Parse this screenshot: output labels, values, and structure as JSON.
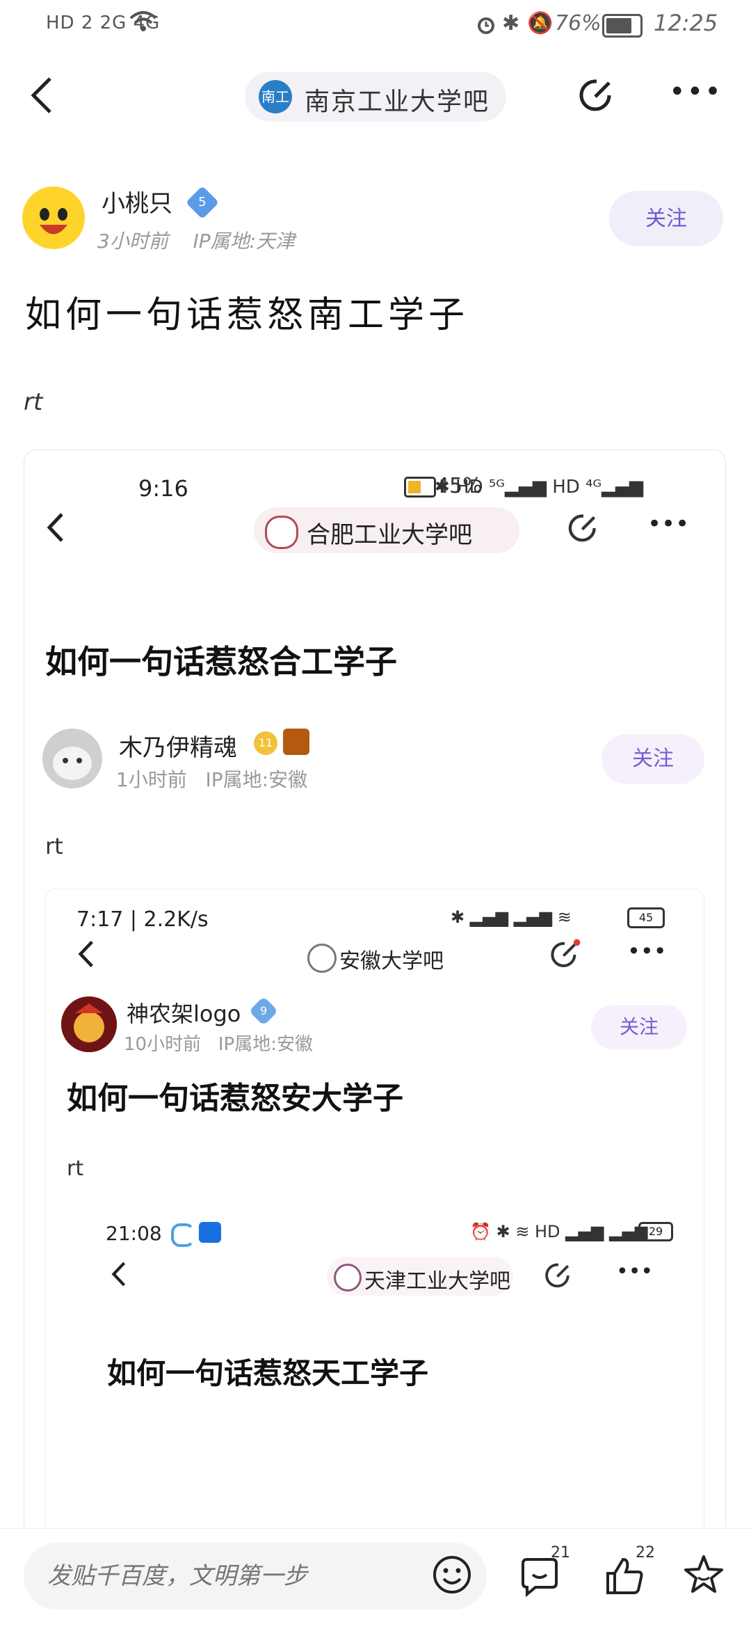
{
  "status_bar": {
    "left": "HD 2  2G  4G",
    "battery": "76%",
    "time": "12:25"
  },
  "nav": {
    "forum_logo_text": "南工",
    "forum_name": "南京工业大学吧"
  },
  "post": {
    "author": "小桃只",
    "level": "5",
    "time": "3小时前",
    "ip": "IP属地:天津",
    "follow": "关注",
    "title": "如何一句话惹怒南工学子",
    "body": "rt"
  },
  "embedded_1": {
    "time": "9:16",
    "battery": "45%",
    "forum_name": "合肥工业大学吧",
    "title": "如何一句话惹怒合工学子",
    "author": "木乃伊精魂",
    "level": "11",
    "meta_time": "1小时前",
    "meta_ip": "IP属地:安徽",
    "follow": "关注",
    "body": "rt"
  },
  "embedded_2": {
    "time": "7:17 | 2.2K/s",
    "battery": "45",
    "forum_name": "安徽大学吧",
    "author": "神农架logo",
    "level": "9",
    "meta_time": "10小时前",
    "meta_ip": "IP属地:安徽",
    "follow": "关注",
    "title": "如何一句话惹怒安大学子",
    "body": "rt"
  },
  "embedded_3": {
    "time": "21:08",
    "battery": "29",
    "forum_name": "天津工业大学吧",
    "title": "如何一句话惹怒天工学子"
  },
  "bottom_bar": {
    "placeholder": "发贴千百度，文明第一步",
    "comments": "21",
    "likes": "22"
  },
  "colors": {
    "follow_bg": "#f1eefa",
    "follow_text": "#6b5bd0",
    "pill_bg": "#f3f1f6",
    "badge_blue": "#5b9be8"
  }
}
